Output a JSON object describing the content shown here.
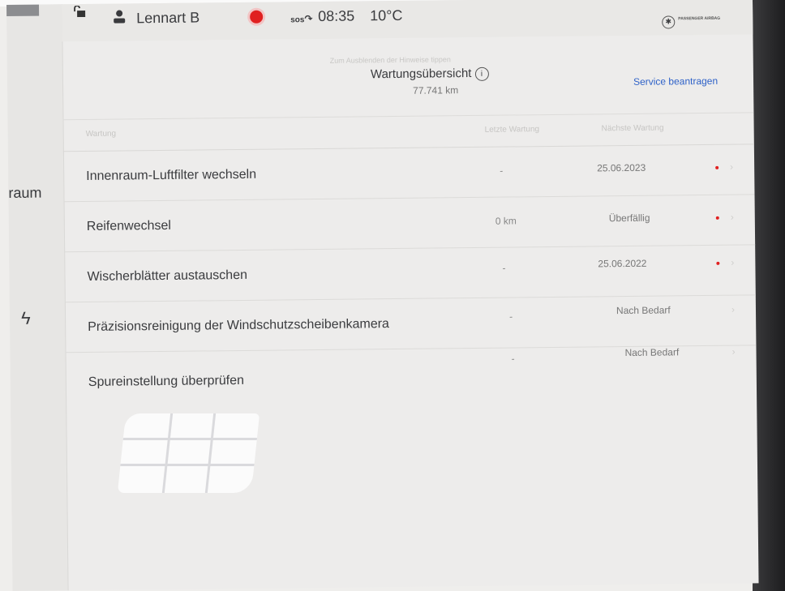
{
  "status_bar": {
    "user_name": "Lennart B",
    "sos_label": "sos",
    "time": "08:35",
    "temperature": "10°C",
    "airbag_label": "PASSENGER AIRBAG"
  },
  "sidebar": {
    "partial_label": "raum",
    "bolt_icon": "bolt-icon"
  },
  "header": {
    "faded_subtitle": "Zum Ausblenden der Hinweise tippen",
    "title": "Wartungsübersicht",
    "odometer": "77.741 km",
    "service_button": "Service beantragen"
  },
  "table": {
    "columns": [
      "Wartung",
      "Letzte Wartung",
      "Nächste Wartung"
    ],
    "rows": [
      {
        "title": "Innenraum-Luftfilter wechseln",
        "last": "-",
        "next": "25.06.2023",
        "alert": true
      },
      {
        "title": "Reifenwechsel",
        "last": "0 km",
        "next": "Überfällig",
        "alert": true
      },
      {
        "title": "Wischerblätter austauschen",
        "last": "-",
        "next": "25.06.2022",
        "alert": true
      },
      {
        "title": "Präzisionsreinigung der Windschutzscheibenkamera",
        "last": "-",
        "next": "Nach Bedarf",
        "alert": false
      },
      {
        "title": "Spureinstellung überprüfen",
        "last": "-",
        "next": "Nach Bedarf",
        "alert": false
      }
    ]
  },
  "colors": {
    "accent_blue": "#2f62c8",
    "alert_red": "#e02020"
  }
}
